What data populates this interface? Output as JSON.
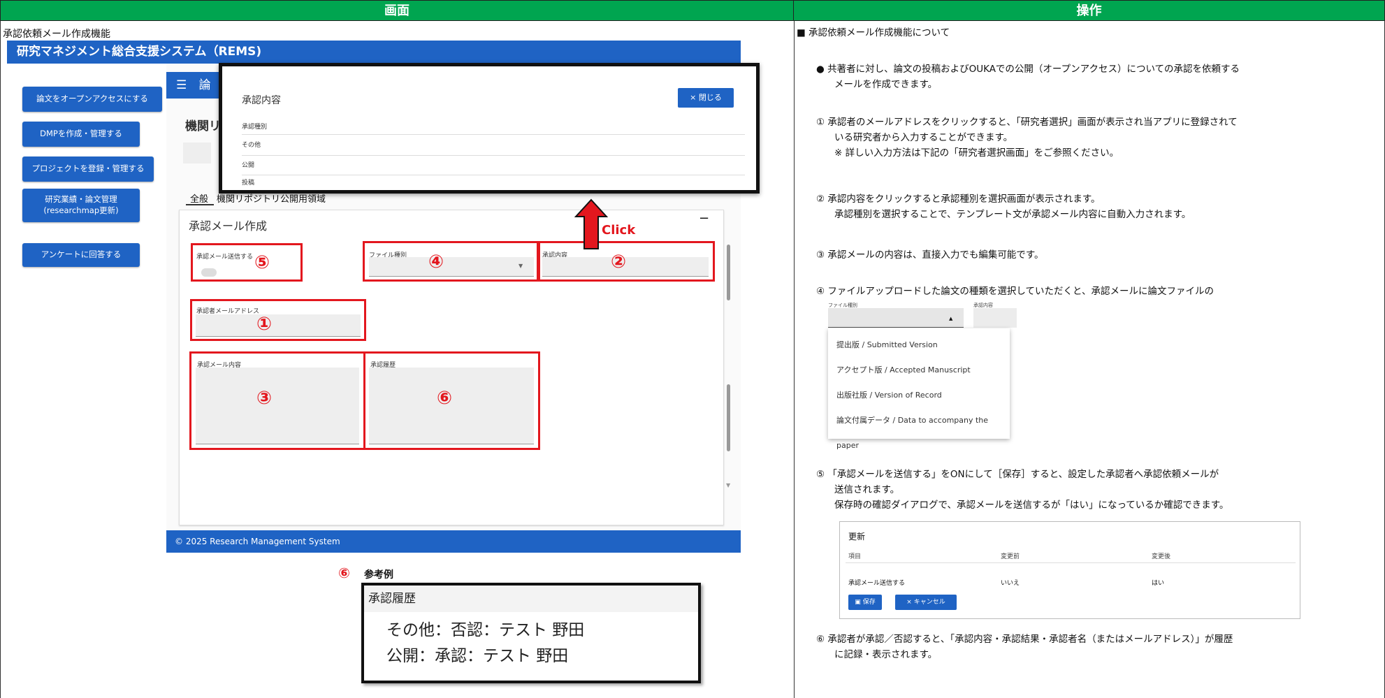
{
  "headers": {
    "left": "画面",
    "right": "操作"
  },
  "left": {
    "section_title": "承認依頼メール作成機能",
    "app_title": "研究マネジメント総合支援システム（REMS)",
    "nav": [
      "論文をオープンアクセスにする",
      "DMPを作成・管理する",
      "プロジェクトを登録・管理する",
      "研究業績・論文管理",
      "(researchmap更新)",
      "アンケートに回答する"
    ],
    "topbar_partial": "論",
    "page_heading_partial": "機関リ",
    "tabs": [
      "全般",
      "機関リポジトリ公開用領域"
    ],
    "form_title": "承認メール作成",
    "collapse": "−",
    "fields": {
      "send": "承認メール送信する",
      "file_type": "ファイル種別",
      "approval_content": "承認内容",
      "approver_email": "承認者メールアドレス",
      "mail_body": "承認メール内容",
      "history": "承認履歴"
    },
    "numbers": [
      "①",
      "②",
      "③",
      "④",
      "⑤",
      "⑥"
    ],
    "footer": "© 2025 Research Management System",
    "click_label": "Click",
    "dialog": {
      "title": "承認内容",
      "close": "× 閉じる",
      "header": "承認種別",
      "options": [
        "その他",
        "公開",
        "投稿"
      ]
    },
    "example_caption": "参考例",
    "example": {
      "title": "承認履歴",
      "lines": [
        "その他：否認：テスト 野田",
        "公開：承認：テスト 野田"
      ]
    }
  },
  "right": {
    "heading": "■ 承認依頼メール作成機能について",
    "bullet_sym": "●",
    "bullet": [
      "共著者に対し、論文の投稿およびOUKAでの公開（オープンアクセス）についての承認を依頼する",
      "メールを作成できます。"
    ],
    "s1": [
      "① 承認者のメールアドレスをクリックすると、「研究者選択」画面が表示され当アプリに登録されて",
      "いる研究者から入力することができます。",
      "※ 詳しい入力方法は下記の「研究者選択画面」をご参照ください。"
    ],
    "s2": [
      "② 承認内容をクリックすると承認種別を選択画面が表示されます。",
      "承認種別を選択することで、テンプレート文が承認メール内容に自動入力されます。"
    ],
    "s3": "③ 承認メールの内容は、直接入力でも編集可能です。",
    "s4": "④ ファイルアップロードした論文の種類を選択していただくと、承認メールに論文ファイルの",
    "mini": {
      "file_label": "ファイル種別",
      "content_label": "承認内容",
      "options": [
        "提出版 / Submitted Version",
        "アクセプト版 / Accepted Manuscript",
        "出版社版 / Version of Record",
        "論文付属データ / Data to accompany the paper"
      ]
    },
    "s5": [
      "⑤ 「承認メールを送信する」をONにして［保存］すると、設定した承認者へ承認依頼メールが",
      "送信されます。",
      "保存時の確認ダイアログで、承認メールを送信するが「はい」になっているか確認できます。"
    ],
    "confirm": {
      "title": "更新",
      "cols": [
        "項目",
        "変更前",
        "変更後"
      ],
      "row": [
        "承認メール送信する",
        "いいえ",
        "はい"
      ],
      "save": "保存",
      "cancel": "× キャンセル"
    },
    "s6": [
      "⑥ 承認者が承認／否認すると、「承認内容・承認結果・承認者名（またはメールアドレス）」が履歴",
      "に記録・表示されます。"
    ]
  }
}
